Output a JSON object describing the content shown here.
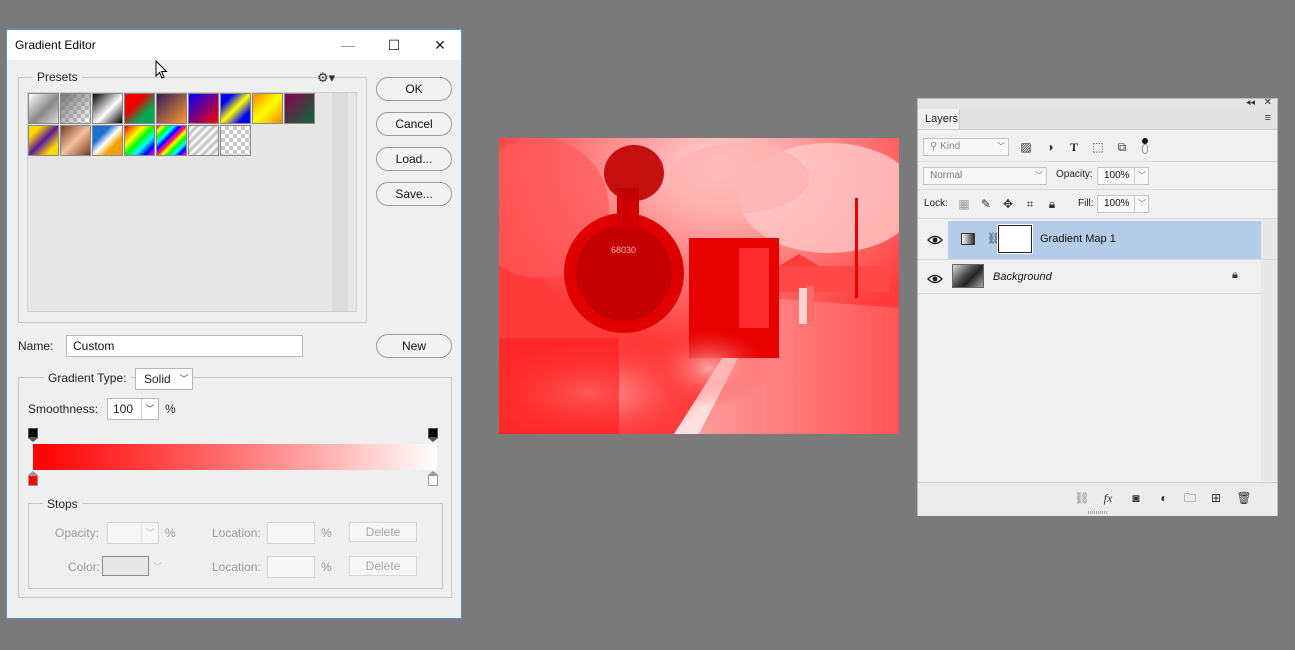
{
  "gradient_editor": {
    "title": "Gradient Editor",
    "window_controls": {
      "minimize": "—",
      "maximize": "☐",
      "close": "✕"
    },
    "presets_legend": "Presets",
    "buttons": {
      "ok": "OK",
      "cancel": "Cancel",
      "load": "Load...",
      "save": "Save...",
      "new": "New"
    },
    "name_label": "Name:",
    "name_value": "Custom",
    "gradient_type_label": "Gradient Type:",
    "gradient_type_value": "Solid",
    "smoothness_label": "Smoothness:",
    "smoothness_value": "100",
    "smoothness_unit": "%",
    "stops_legend": "Stops",
    "opacity_label": "Opacity:",
    "opacity_unit": "%",
    "location_label": "Location:",
    "location_unit": "%",
    "color_label": "Color:",
    "delete_label": "Delete",
    "gradient_colors": {
      "start": "#ff0000",
      "end": "#ffffff"
    }
  },
  "layers_panel": {
    "tab": "Layers",
    "filter_kind": "Kind",
    "blend_mode": "Normal",
    "opacity_label": "Opacity:",
    "opacity_value": "100%",
    "lock_label": "Lock:",
    "fill_label": "Fill:",
    "fill_value": "100%",
    "layers": [
      {
        "name": "Gradient Map 1",
        "selected": true
      },
      {
        "name": "Background",
        "selected": false,
        "locked": true
      }
    ]
  },
  "canvas": {
    "loco_number": "68030",
    "tint": "#ff2020"
  }
}
